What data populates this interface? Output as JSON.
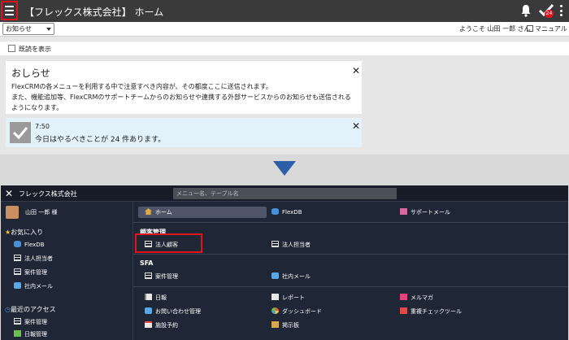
{
  "appbar": {
    "title": "【フレックス株式会社】 ホーム",
    "badge_count": "24",
    "icons": [
      "hamburger-icon",
      "bell-icon",
      "todo-check-icon",
      "kebab-icon"
    ]
  },
  "subbar": {
    "select_value": "お知らせ",
    "welcome": "ようこそ 山田 一郎 さん",
    "manual": "マニュアル"
  },
  "read_toggle": {
    "label": "既読を表示"
  },
  "notice": {
    "title": "おしらせ",
    "close": "✕",
    "line1": "FlexCRMの各メニューを利用する中で注意すべき内容が、その都度ここに送信されます。",
    "line2": "また、機能追加等、FlexCRMのサポートチームからのお知らせや連携する外部サービスからのお知らせも送信されるようになります。"
  },
  "todo": {
    "time": "7:50",
    "message": "今日はやるべきことが 24 件あります。",
    "close": "✕"
  },
  "menu": {
    "close": "✕",
    "company": "フレックス株式会社",
    "search_placeholder": "メニュー名、テーブル名",
    "user": "山田 一郎 様",
    "favorites_title": "お気に入り",
    "favorites": [
      "FlexDB",
      "法人担当者",
      "案件管理",
      "社内メール"
    ],
    "recent_title": "最近のアクセス",
    "recent": [
      "案件管理",
      "日報管理"
    ],
    "top_row": {
      "home": "ホーム",
      "flexdb": "FlexDB",
      "support_mail": "サポートメール"
    },
    "section_customer": "顧客管理",
    "customer_items": {
      "corp_client": "法人顧客",
      "corp_contact": "法人担当者"
    },
    "section_sfa": "SFA",
    "sfa_items": {
      "deals": "案件管理",
      "internal_mail": "社内メール"
    },
    "other_items": {
      "daily_report": "日報",
      "report": "レポート",
      "mail_magazine": "メルマガ",
      "inquiry": "お問い合わせ管理",
      "dashboard": "ダッシュボード",
      "duplicate_check": "重複チェックツール",
      "facility": "施設予約",
      "board": "掲示板"
    }
  },
  "colors": {
    "highlight": "#e0141e",
    "arrow": "#2c5fa8",
    "appbar": "#3a3a3a",
    "menu_bg": "#1f2635"
  }
}
